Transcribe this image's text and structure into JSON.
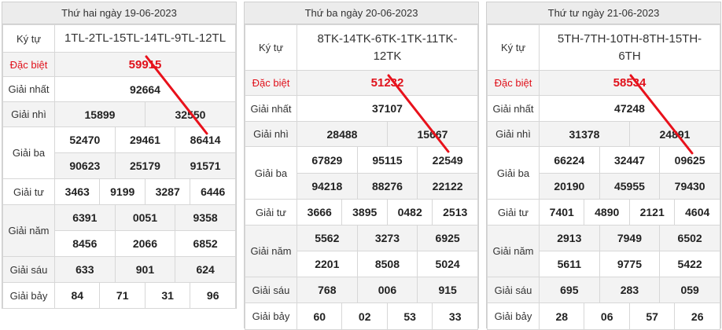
{
  "days": [
    {
      "title": "Thứ hai ngày 19-06-2023",
      "labels": {
        "code": "Ký tự",
        "special": "Đặc biệt",
        "first": "Giải nhất",
        "second": "Giải nhì",
        "third": "Giải ba",
        "fourth": "Giải tư",
        "fifth": "Giải năm",
        "sixth": "Giải sáu",
        "seventh": "Giải bảy"
      },
      "code": "1TL-2TL-15TL-14TL-9TL-12TL",
      "special": "59915",
      "first": "92664",
      "second": [
        "15899",
        "32550"
      ],
      "third": [
        "52470",
        "29461",
        "86414",
        "90623",
        "25179",
        "91571"
      ],
      "fourth": [
        "3463",
        "9199",
        "3287",
        "6446"
      ],
      "fifth": [
        "6391",
        "0051",
        "9358",
        "8456",
        "2066",
        "6852"
      ],
      "sixth": [
        "633",
        "901",
        "624"
      ],
      "seventh": [
        "84",
        "71",
        "31",
        "96"
      ]
    },
    {
      "title": "Thứ ba ngày 20-06-2023",
      "labels": {
        "code": "Ký tự",
        "special": "Đặc biệt",
        "first": "Giải nhất",
        "second": "Giải nhì",
        "third": "Giải ba",
        "fourth": "Giải tư",
        "fifth": "Giải năm",
        "sixth": "Giải sáu",
        "seventh": "Giải bảy"
      },
      "code": "8TK-14TK-6TK-1TK-11TK-12TK",
      "special": "51232",
      "first": "37107",
      "second": [
        "28488",
        "15667"
      ],
      "third": [
        "67829",
        "95115",
        "22549",
        "94218",
        "88276",
        "22122"
      ],
      "fourth": [
        "3666",
        "3895",
        "0482",
        "2513"
      ],
      "fifth": [
        "5562",
        "3273",
        "6925",
        "2201",
        "8508",
        "5024"
      ],
      "sixth": [
        "768",
        "006",
        "915"
      ],
      "seventh": [
        "60",
        "02",
        "53",
        "33"
      ]
    },
    {
      "title": "Thứ tư ngày 21-06-2023",
      "labels": {
        "code": "Ký tự",
        "special": "Đặc biệt",
        "first": "Giải nhất",
        "second": "Giải nhì",
        "third": "Giải ba",
        "fourth": "Giải tư",
        "fifth": "Giải năm",
        "sixth": "Giải sáu",
        "seventh": "Giải bảy"
      },
      "code": "5TH-7TH-10TH-8TH-15TH-6TH",
      "special": "58534",
      "first": "47248",
      "second": [
        "31378",
        "24891"
      ],
      "third": [
        "66224",
        "32447",
        "09625",
        "20190",
        "45955",
        "79430"
      ],
      "fourth": [
        "7401",
        "4890",
        "2121",
        "4604"
      ],
      "fifth": [
        "2913",
        "7949",
        "6502",
        "5611",
        "9775",
        "5422"
      ],
      "sixth": [
        "695",
        "283",
        "059"
      ],
      "seventh": [
        "28",
        "06",
        "57",
        "26"
      ]
    }
  ],
  "colors": {
    "special": "#e0111b",
    "strike_line": "#e8111b",
    "header_bg": "#ececec"
  }
}
